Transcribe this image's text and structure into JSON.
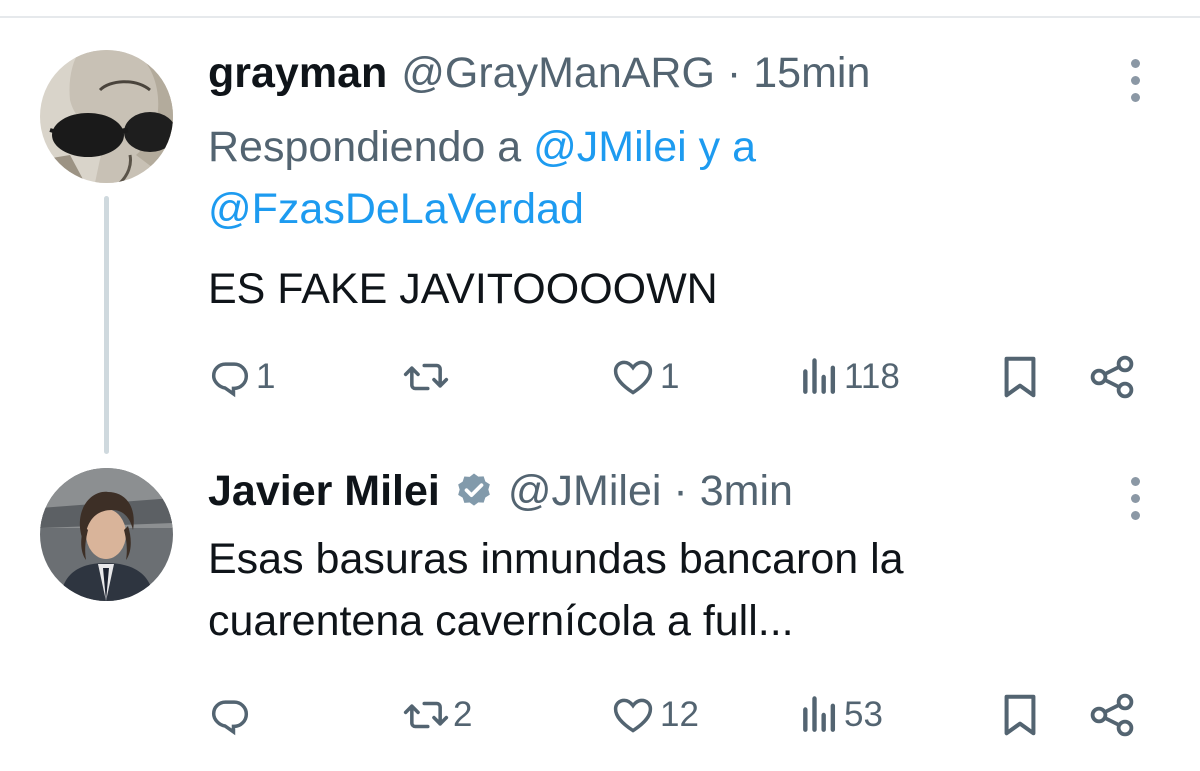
{
  "thread": [
    {
      "display_name": "grayman",
      "handle": "@GrayManARG",
      "separator": "·",
      "time": "15min",
      "verified": false,
      "replying_to": {
        "prefix": "Respondiendo a",
        "mention_1": "@JMilei",
        "conjunction": "y a",
        "mention_2": "@FzasDeLaVerdad"
      },
      "text": "ES FAKE JAVITOOOOWN",
      "stats": {
        "replies": "1",
        "reposts": "",
        "likes": "1",
        "views": "118"
      }
    },
    {
      "display_name": "Javier Milei",
      "handle": "@JMilei",
      "separator": "·",
      "time": "3min",
      "verified": true,
      "text_line_1": "Esas basuras inmundas bancaron la",
      "text_line_2": "cuarentena cavernícola a full...",
      "stats": {
        "replies": "",
        "reposts": "2",
        "likes": "12",
        "views": "53"
      }
    }
  ],
  "colors": {
    "text_primary": "#0f1419",
    "text_secondary": "#536471",
    "accent": "#1d9bf0",
    "thread_line": "#cfd9de",
    "verified_badge": "#829aab"
  },
  "icons": [
    "more-icon",
    "reply-icon",
    "repost-icon",
    "like-icon",
    "views-icon",
    "bookmark-icon",
    "share-icon",
    "verified-badge-icon"
  ]
}
